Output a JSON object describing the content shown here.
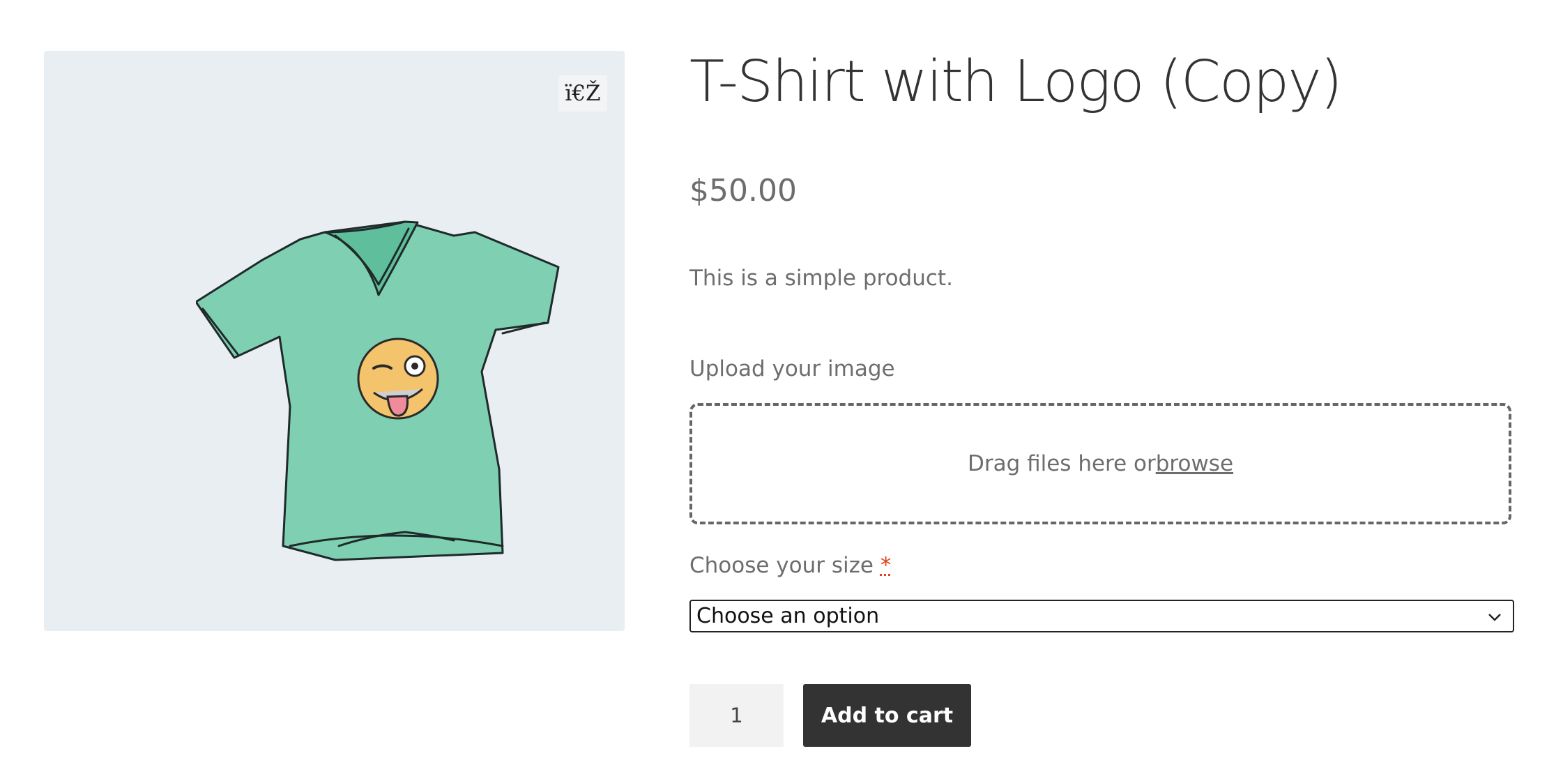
{
  "gallery": {
    "zoom_glyph": "ï€Ž",
    "image_icon": "tshirt-with-winking-emoji",
    "background": "#e8eef1"
  },
  "product": {
    "title": "T-Shirt with Logo (Copy)",
    "price": "$50.00",
    "description": "This is a simple product."
  },
  "upload": {
    "label": "Upload your image",
    "drop_text": "Drag files here or ",
    "browse_label": "browse"
  },
  "size": {
    "label": "Choose your size ",
    "required_mark": "*",
    "selected": "Choose an option"
  },
  "cart": {
    "quantity": "1",
    "button_label": "Add to cart",
    "button_color": "#333333"
  }
}
